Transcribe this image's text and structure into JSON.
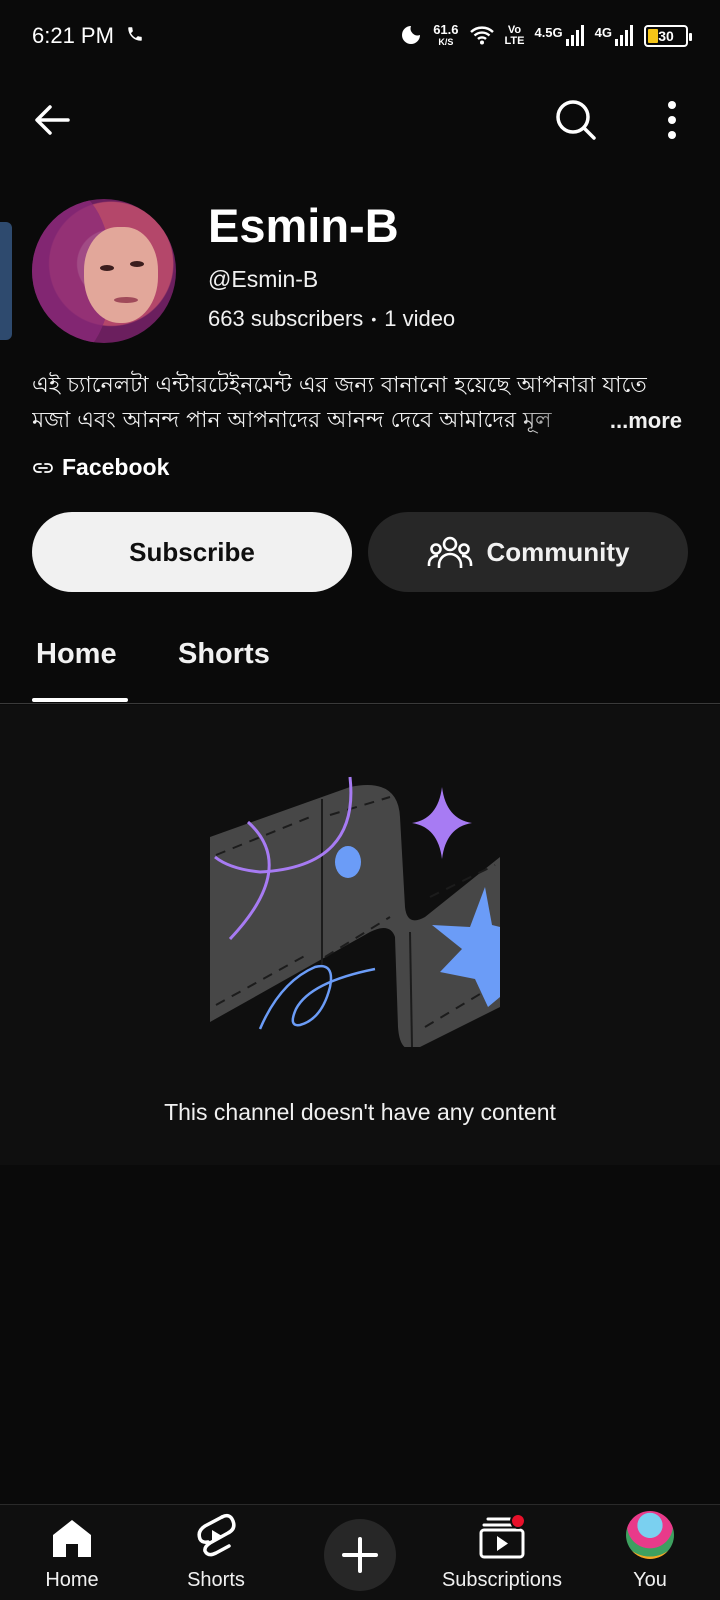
{
  "status_bar": {
    "time": "6:21 PM",
    "net_speed": "61.6",
    "net_unit": "K/S",
    "volte_top": "Vo",
    "volte_bottom": "LTE",
    "signal1": "4.5G",
    "signal2": "4G",
    "battery": "30"
  },
  "top_bar": {
    "back_icon": "arrow-left-icon",
    "search_icon": "search-icon",
    "more_icon": "more-vertical-icon"
  },
  "channel": {
    "name": "Esmin-B",
    "handle": "@Esmin-B",
    "subscribers": "663 subscribers",
    "separator": "•",
    "videos": "1 video",
    "description_line1": "এই চ্যানেলটা এন্টারটেইনমেন্ট এর জন্য বানানো হয়েছে আপনারা যাতে",
    "description_line2": "মজা এবং আনন্দ পান আপনাদের আনন্দ দেবে আমাদের মূল",
    "more_label": "...more",
    "link_label": "Facebook"
  },
  "actions": {
    "subscribe_label": "Subscribe",
    "community_label": "Community"
  },
  "tabs": [
    {
      "label": "Home",
      "active": true
    },
    {
      "label": "Shorts",
      "active": false
    }
  ],
  "empty_state": {
    "message": "This channel doesn't have any content"
  },
  "bottom_nav": {
    "home": "Home",
    "shorts": "Shorts",
    "subscriptions": "Subscriptions",
    "you": "You"
  },
  "colors": {
    "background": "#0a0a0a",
    "accent_purple": "#a77bf3",
    "accent_blue": "#6b9cf7",
    "notification": "#e8102a"
  }
}
